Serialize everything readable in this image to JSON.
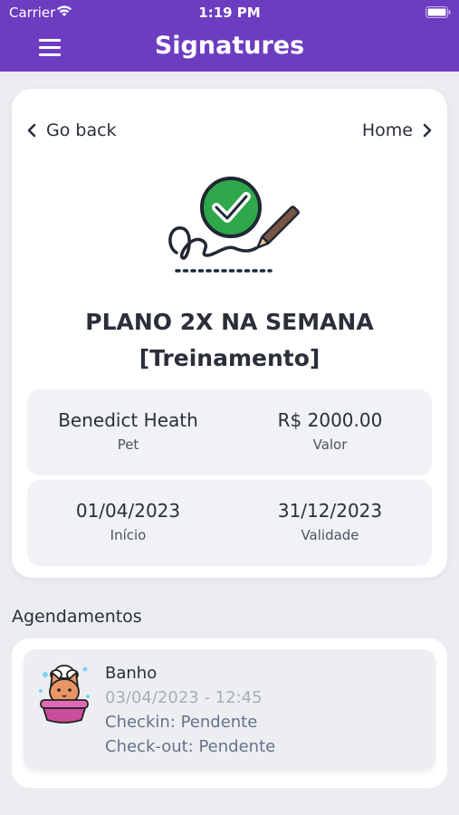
{
  "status_bar": {
    "carrier": "Carrier",
    "time": "1:19 PM"
  },
  "header": {
    "title": "Signatures",
    "menu_icon": "hamburger-menu-icon"
  },
  "nav": {
    "back_label": "Go back",
    "home_label": "Home"
  },
  "plan": {
    "title": "PLANO 2X NA SEMANA",
    "subtitle": "[Treinamento]"
  },
  "details": {
    "pet_value": "Benedict Heath",
    "pet_label": "Pet",
    "price_value": "R$ 2000.00",
    "price_label": "Valor",
    "start_value": "01/04/2023",
    "start_label": "Início",
    "end_value": "31/12/2023",
    "end_label": "Validade"
  },
  "appointments": {
    "title": "Agendamentos",
    "items": [
      {
        "service": "Banho",
        "datetime": "03/04/2023 - 12:45",
        "checkin": "Checkin: Pendente",
        "checkout": "Check-out: Pendente",
        "icon": "pet-bath-icon"
      }
    ]
  },
  "colors": {
    "header": "#6c3dc1",
    "check_green": "#2ea84a",
    "background": "#ebedf1"
  }
}
